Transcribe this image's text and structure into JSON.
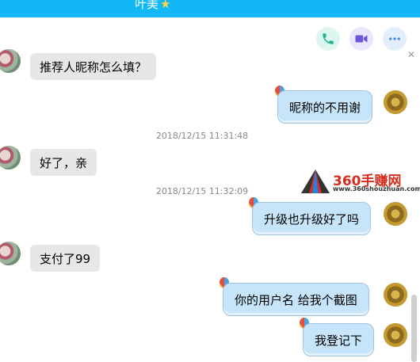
{
  "header": {
    "title": "叶美"
  },
  "toolbar": {
    "call_icon": "phone-icon",
    "video_icon": "video-camera-icon",
    "more_icon": "more-icon"
  },
  "messages": [
    {
      "from": "them",
      "text": "推荐人昵称怎么填？"
    },
    {
      "from": "me",
      "text": "昵称的不用谢"
    },
    {
      "timestamp": "2018/12/15 11:31:48"
    },
    {
      "from": "them",
      "text": "好了，亲"
    },
    {
      "timestamp": "2018/12/15 11:32:09"
    },
    {
      "from": "me",
      "text": "升级也升级好了吗"
    },
    {
      "from": "them",
      "text": "支付了99"
    },
    {
      "from": "me",
      "text": "你的用户名 给我个截图"
    },
    {
      "from": "me",
      "text": "我登记下"
    }
  ],
  "watermark": {
    "text": "360手赚网",
    "url": "www.360shouzhuan.com"
  },
  "colors": {
    "accent": "#12b7f5",
    "my_bubble": "#c6e4fa",
    "their_bubble": "#e7e7e7"
  }
}
